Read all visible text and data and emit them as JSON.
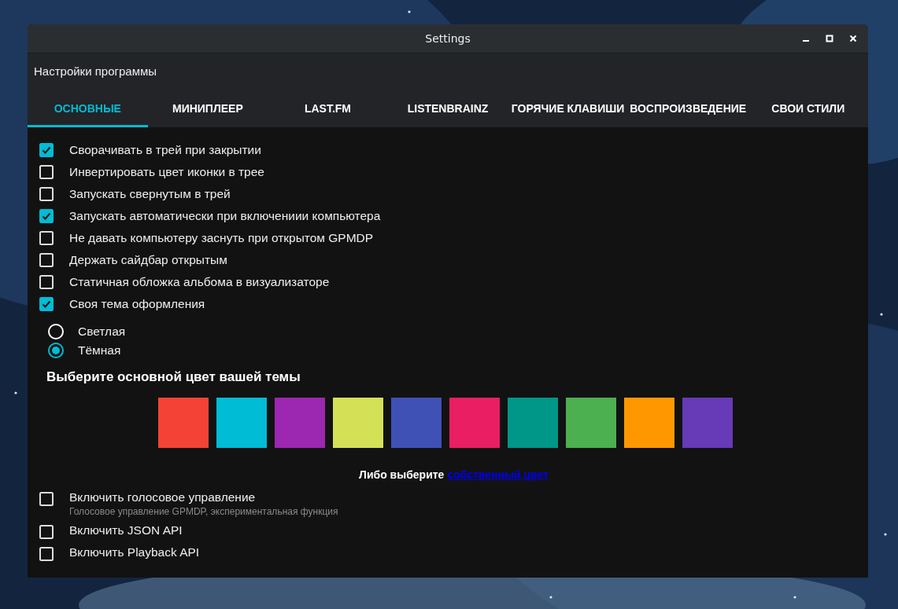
{
  "window": {
    "title": "Settings"
  },
  "header": {
    "title": "Настройки программы"
  },
  "tabs": [
    {
      "label": "ОСНОВНЫЕ",
      "selected": true
    },
    {
      "label": "МИНИПЛЕЕР",
      "selected": false
    },
    {
      "label": "LAST.FM",
      "selected": false
    },
    {
      "label": "LISTENBRAINZ",
      "selected": false
    },
    {
      "label": "ГОРЯЧИЕ КЛАВИШИ",
      "selected": false
    },
    {
      "label": "ВОСПРОИЗВЕДЕНИЕ",
      "selected": false
    },
    {
      "label": "СВОИ СТИЛИ",
      "selected": false
    }
  ],
  "options": [
    {
      "label": "Сворачивать в трей при закрытии",
      "checked": true
    },
    {
      "label": "Инвертировать цвет иконки в трее",
      "checked": false
    },
    {
      "label": "Запускать свернутым в трей",
      "checked": false
    },
    {
      "label": "Запускать автоматически при включениии компьютера",
      "checked": true
    },
    {
      "label": "Не давать компьютеру заснуть при открытом GPMDP",
      "checked": false
    },
    {
      "label": "Держать сайдбар открытым",
      "checked": false
    },
    {
      "label": "Статичная обложка альбома в визуализаторе",
      "checked": false
    },
    {
      "label": "Своя тема оформления",
      "checked": true
    }
  ],
  "theme_modes": [
    {
      "label": "Светлая",
      "selected": false
    },
    {
      "label": "Тёмная",
      "selected": true
    }
  ],
  "color_heading": "Выберите основной цвет вашей темы",
  "swatches": [
    {
      "color": "#f44336"
    },
    {
      "color": "#00bcd4"
    },
    {
      "color": "#9c27b0"
    },
    {
      "color": "#d4e157"
    },
    {
      "color": "#3f51b5"
    },
    {
      "color": "#e91e63"
    },
    {
      "color": "#009688"
    },
    {
      "color": "#4caf50"
    },
    {
      "color": "#ff9800"
    },
    {
      "color": "#673ab7"
    }
  ],
  "custom_color": {
    "text": "Либо выберите",
    "link": "собственный цвет"
  },
  "more_options": [
    {
      "label": "Включить голосовое управление",
      "checked": false,
      "hint": "Голосовое управление GPMDP, экспериментальная функция"
    },
    {
      "label": "Включить JSON API",
      "checked": false
    },
    {
      "label": "Включить Playback API",
      "checked": false
    }
  ]
}
